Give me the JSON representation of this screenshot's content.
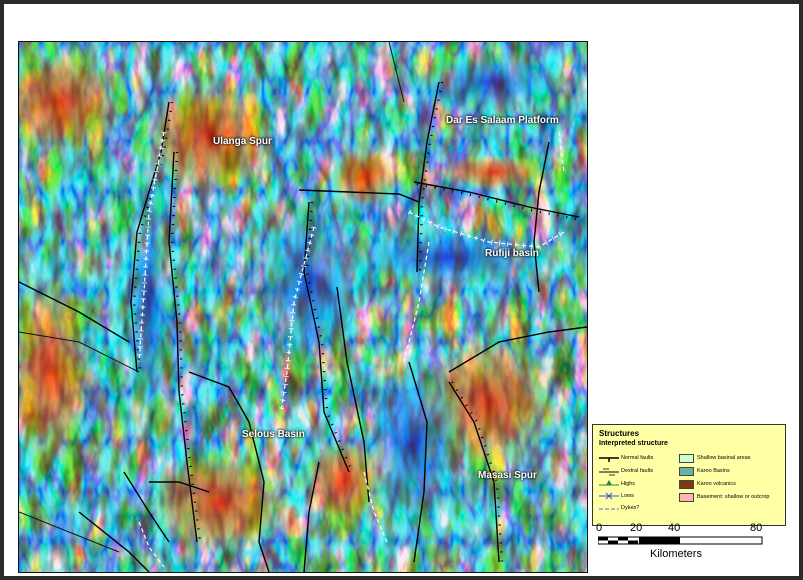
{
  "map": {
    "labels": {
      "ulanga": "Ulanga Spur",
      "daressalaam": "Dar Es Salaam Platform",
      "rufiji": "Rufiji basin",
      "selous": "Selous Basin",
      "masasi": "Masasi Spur"
    }
  },
  "legend": {
    "title": "Structures",
    "subtitle": "Interpreted structure",
    "items": {
      "normal_faults": "Normal faults",
      "dextral_faults": "Dextral faults",
      "highs": "Highs",
      "lows": "Lows",
      "dykes": "Dykes?",
      "shallow_basinal": "Shallow basinal areas",
      "karoo_basins": "Karoo Basins",
      "karoo_volcanics": "Karoo volcanics",
      "basement": "Basement: shallow or outcrop"
    },
    "colors": {
      "shallow_basinal": "#ccffcc",
      "karoo_basins": "#66b3a6",
      "karoo_volcanics": "#7a3a12",
      "basement": "#ffb3b3"
    }
  },
  "scale": {
    "ticks": [
      "0",
      "20",
      "40",
      "80"
    ],
    "units": "Kilometers"
  }
}
